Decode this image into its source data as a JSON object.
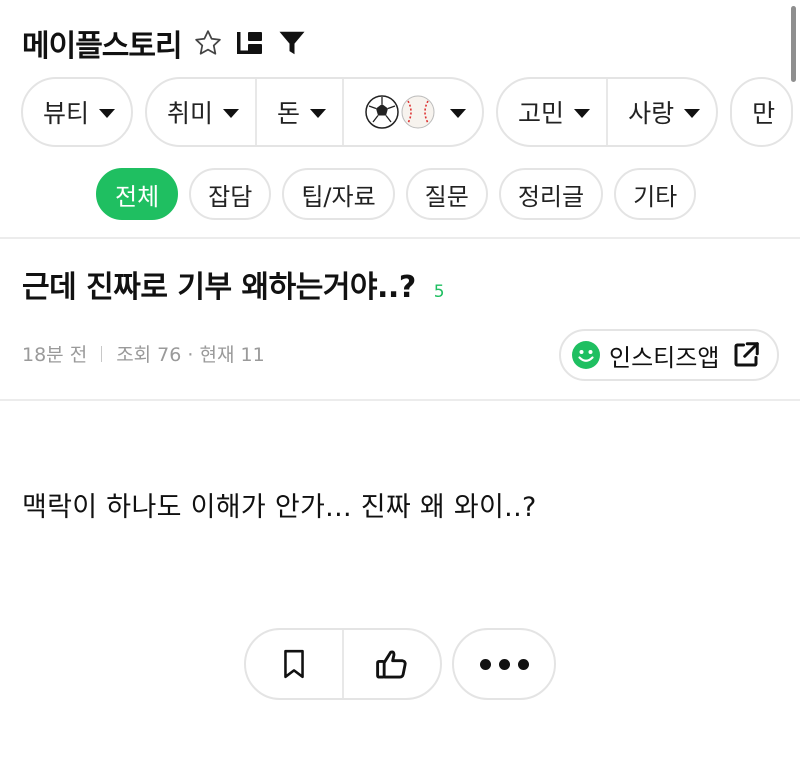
{
  "header": {
    "board_title": "메이플스토리",
    "icons": [
      "star-outline-icon",
      "board-list-icon",
      "filter-icon"
    ]
  },
  "categories": {
    "groups": [
      {
        "items": [
          {
            "label": "뷰티"
          }
        ]
      },
      {
        "items": [
          {
            "label": "취미"
          },
          {
            "label": "돈"
          },
          {
            "label": "⚽⚾",
            "icon": "sports-balls-icon"
          }
        ]
      },
      {
        "items": [
          {
            "label": "고민"
          },
          {
            "label": "사랑"
          }
        ]
      },
      {
        "items": [
          {
            "label": "만"
          }
        ]
      }
    ]
  },
  "tags": [
    "전체",
    "잡담",
    "팁/자료",
    "질문",
    "정리글",
    "기타"
  ],
  "active_tag": "전체",
  "post": {
    "title": "근데 진짜로 기부 왜하는거야..?",
    "comment_count": "5",
    "time": "18분 전",
    "views": "조회 76 · 현재 11",
    "app_button": "인스티즈앱",
    "body": "맥락이 하나도 이해가 안가... 진짜 왜 와이..?"
  },
  "actions": {
    "icons": [
      "bookmark-icon",
      "thumbs-up-icon",
      "more-dots-icon"
    ]
  },
  "colors": {
    "accent": "#1fbf61",
    "border": "#e4e4e4",
    "meta_text": "#9a9a9a"
  }
}
